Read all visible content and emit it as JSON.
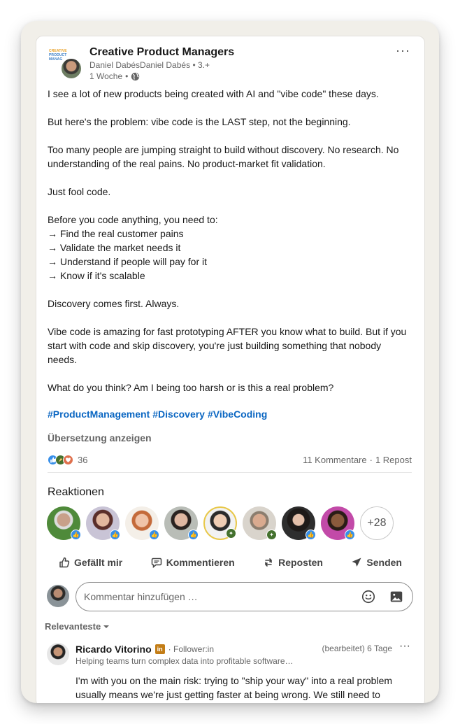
{
  "post": {
    "group_name": "Creative Product Managers",
    "group_logo_lines": [
      "CREATIVE",
      "PRODUCT",
      "MANAG"
    ],
    "author_line": "Daniel DabésDaniel Dabés",
    "author_degree": "3.+",
    "time": "1 Woche",
    "more_label": "···",
    "paragraphs": [
      "I see a lot of new products being created with AI and \"vibe code\" these days.",
      "But here's the problem: vibe code is the LAST step, not the beginning.",
      "Too many people are jumping straight to build without discovery. No research. No understanding of the real pains. No product-market fit validation.",
      "Just fool code."
    ],
    "list_intro": "Before you code anything, you need to:",
    "list_items": [
      "→ Find the real customer pains",
      "→ Validate the market needs it",
      "→ Understand if people will pay for it",
      "→ Know if it's scalable"
    ],
    "closing_paragraphs": [
      "Discovery comes first. Always.",
      "Vibe code is amazing for fast prototyping AFTER you know what to build. But if you start with code and skip discovery, you're just building something that nobody needs.",
      "What do you think? Am I being too harsh or is this a real problem?"
    ],
    "hashtags": [
      "#ProductManagement",
      "#Discovery",
      "#VibeCoding"
    ],
    "translate_label": "Übersetzung anzeigen"
  },
  "stats": {
    "reaction_count": "36",
    "comments": "11 Kommentare",
    "separator": "·",
    "reposts": "1 Repost"
  },
  "reactions": {
    "heading": "Reaktionen",
    "more_count": "+28"
  },
  "actions": {
    "like": "Gefällt mir",
    "comment": "Kommentieren",
    "repost": "Reposten",
    "send": "Senden"
  },
  "composer": {
    "placeholder": "Kommentar hinzufügen …"
  },
  "sort": {
    "label": "Relevanteste"
  },
  "comment": {
    "name": "Ricardo Vitorino",
    "badge": "in",
    "follower": "· Follower:in",
    "meta": "(bearbeitet) 6 Tage",
    "more_label": "···",
    "headline": "Helping teams turn complex data into profitable software…",
    "text": "I'm with you on the main risk: trying to \"ship your way\" into a real problem usually means we're just getting faster at being wrong. We still need to"
  },
  "colors": {
    "link": "#0a66c2",
    "like": "#378fe9",
    "celebrate": "#44712e",
    "love": "#df704d",
    "frame": "#f1efe9"
  }
}
